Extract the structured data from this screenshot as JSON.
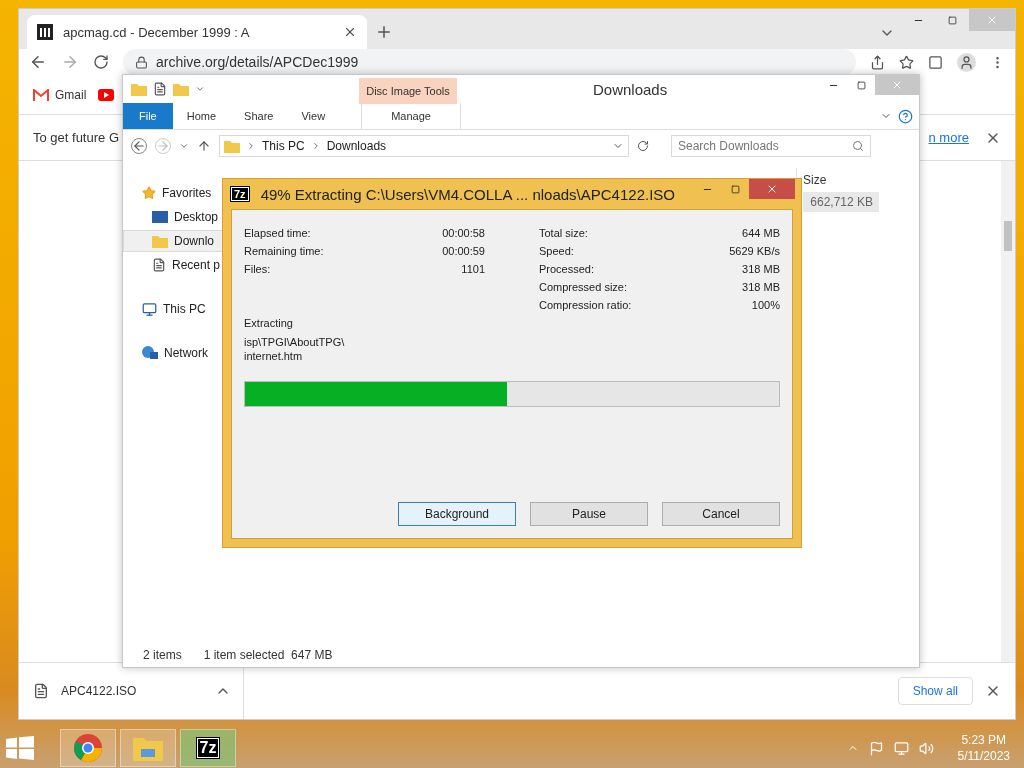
{
  "browser": {
    "tab_title": "apcmag.cd - December 1999 : A",
    "address": "archive.org/details/APCDec1999",
    "bookmarks": [
      {
        "label": "Gmail",
        "kind": "gmail"
      },
      {
        "kind": "youtube"
      }
    ],
    "infobar": {
      "text": "To get future G",
      "link": "n more"
    },
    "download": {
      "file": "APC4122.ISO",
      "show_all": "Show all"
    }
  },
  "explorer": {
    "title": "Downloads",
    "contextual_tab": "Disc Image Tools",
    "ribbon_tabs": [
      {
        "label": "File",
        "kind": "file"
      },
      {
        "label": "Home",
        "kind": "tab"
      },
      {
        "label": "Share",
        "kind": "tab"
      },
      {
        "label": "View",
        "kind": "tab"
      },
      {
        "label": "Manage",
        "kind": "context"
      }
    ],
    "breadcrumb": [
      "This PC",
      "Downloads"
    ],
    "search": {
      "placeholder": "Search Downloads"
    },
    "nav": [
      {
        "label": "Favorites",
        "kind": "star",
        "selected": false,
        "children": [
          {
            "label": "Desktop",
            "kind": "desktop",
            "selected": false
          },
          {
            "label": "Downlo",
            "kind": "downloads",
            "selected": true
          },
          {
            "label": "Recent p",
            "kind": "recent",
            "selected": false
          }
        ]
      },
      {
        "label": "This PC",
        "kind": "pc",
        "selected": false
      },
      {
        "label": "Network",
        "kind": "network",
        "selected": false
      }
    ],
    "columns": [
      {
        "label": "Size"
      }
    ],
    "file_size": "662,712 KB",
    "status": [
      "2 items",
      "1 item selected  647 MB"
    ]
  },
  "dialog": {
    "logo": "7z",
    "title": "49% Extracting C:\\Users\\VM4.COLLA ... nloads\\APC4122.ISO",
    "left_stats": [
      {
        "label": "Elapsed time:",
        "value": "00:00:58"
      },
      {
        "label": "Remaining time:",
        "value": "00:00:59"
      },
      {
        "label": "Files:",
        "value": "1101"
      }
    ],
    "right_stats": [
      {
        "label": "Total size:",
        "value": "644 MB"
      },
      {
        "label": "Speed:",
        "value": "5629 KB/s"
      },
      {
        "label": "Processed:",
        "value": "318 MB"
      },
      {
        "label": "Compressed size:",
        "value": "318 MB"
      },
      {
        "label": "Compression ratio:",
        "value": "100%"
      }
    ],
    "current_label": "Extracting",
    "current_path": [
      "isp\\TPGI\\AboutTPG\\",
      "internet.htm"
    ],
    "progress": {
      "level": 0.49
    },
    "buttons": [
      {
        "label": "Background",
        "selected": true
      },
      {
        "label": "Pause",
        "selected": false
      },
      {
        "label": "Cancel",
        "selected": false
      }
    ]
  },
  "taskbar": {
    "apps": [
      {
        "kind": "chrome",
        "active": false
      },
      {
        "kind": "explorer",
        "active": false
      },
      {
        "kind": "sevenzip",
        "label": "7z",
        "active": true
      }
    ],
    "time": "5:23 PM",
    "date": "5/11/2023"
  }
}
